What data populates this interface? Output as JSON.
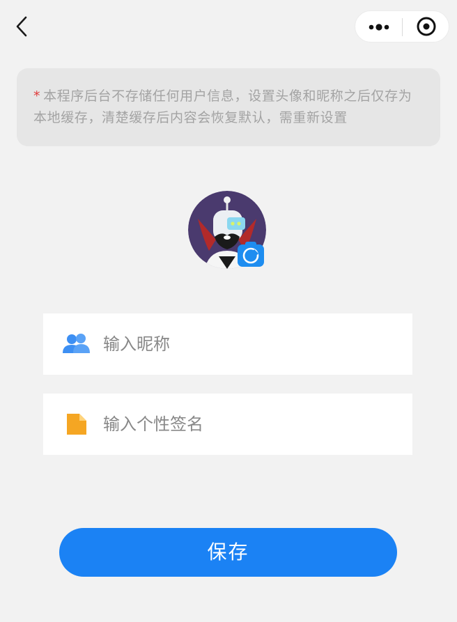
{
  "nav": {
    "back_icon": "chevron-left-icon",
    "more_icon": "more-dots-icon",
    "close_icon": "target-circle-icon"
  },
  "notice": {
    "star": "*",
    "text": "本程序后台不存储任何用户信息，设置头像和昵称之后仅存为本地缓存，清楚缓存后内容会恢复默认，需重新设置"
  },
  "avatar": {
    "image_icon": "robot-avatar-icon",
    "badge_icon": "camera-icon"
  },
  "form": {
    "nickname": {
      "icon": "users-icon",
      "placeholder": "输入昵称",
      "value": ""
    },
    "signature": {
      "icon": "document-icon",
      "placeholder": "输入个性签名",
      "value": ""
    }
  },
  "save_button": {
    "label": "保存"
  },
  "colors": {
    "accent": "#1b82f4",
    "background": "#f2f2f2",
    "notice_bg": "#e6e6e6",
    "notice_text": "#a3a3a3",
    "star": "#e03a3a",
    "signature_icon": "#f5a623"
  }
}
